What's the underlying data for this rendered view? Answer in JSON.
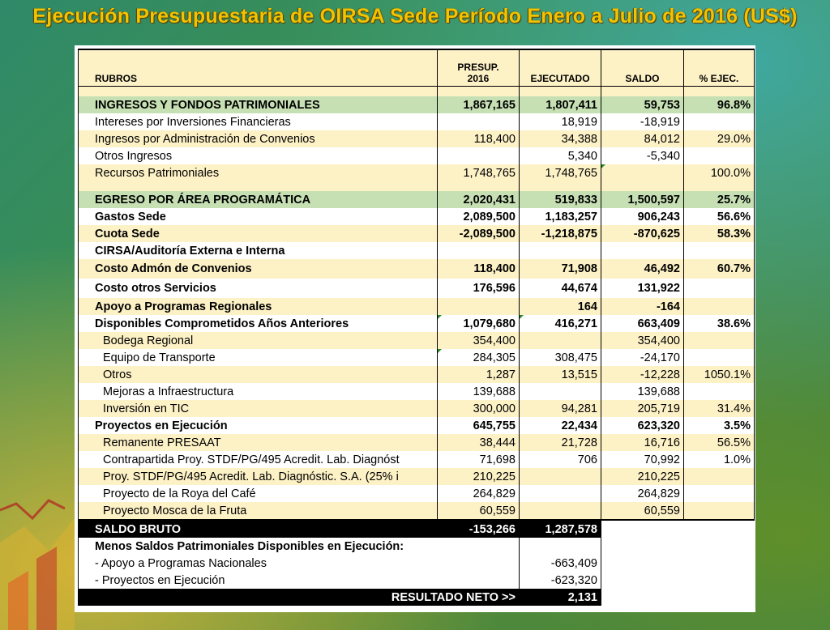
{
  "title": "Ejecución Presupuestaria de OIRSA Sede Período Enero a Julio de 2016 (US$)",
  "columns": {
    "rubros": "RUBROS",
    "presup_line1": "PRESUP.",
    "presup_line2": "2016",
    "ejecutado": "EJECUTADO",
    "saldo": "SALDO",
    "pct": "% EJEC."
  },
  "rows": [
    {
      "label": "INGRESOS Y FONDOS PATRIMONIALES",
      "presup": "1,867,165",
      "ejec": "1,807,411",
      "saldo": "59,753",
      "pct": "96.8%"
    },
    {
      "label": "Intereses por Inversiones Financieras",
      "presup": "",
      "ejec": "18,919",
      "saldo": "-18,919",
      "pct": ""
    },
    {
      "label": "Ingresos por Administración de Convenios",
      "presup": "118,400",
      "ejec": "34,388",
      "saldo": "84,012",
      "pct": "29.0%"
    },
    {
      "label": "Otros Ingresos",
      "presup": "",
      "ejec": "5,340",
      "saldo": "-5,340",
      "pct": ""
    },
    {
      "label": "Recursos Patrimoniales",
      "presup": "1,748,765",
      "ejec": "1,748,765",
      "saldo": "",
      "pct": "100.0%"
    },
    {
      "label": "EGRESO POR ÁREA PROGRAMÁTICA",
      "presup": "2,020,431",
      "ejec": "519,833",
      "saldo": "1,500,597",
      "pct": "25.7%"
    },
    {
      "label": "Gastos Sede",
      "presup": "2,089,500",
      "ejec": "1,183,257",
      "saldo": "906,243",
      "pct": "56.6%"
    },
    {
      "label": "Cuota Sede",
      "presup": "-2,089,500",
      "ejec": "-1,218,875",
      "saldo": "-870,625",
      "pct": "58.3%"
    },
    {
      "label": "CIRSA/Auditoría Externa e Interna",
      "presup": "",
      "ejec": "",
      "saldo": "",
      "pct": ""
    },
    {
      "label": "Costo Admón de Convenios",
      "presup": "118,400",
      "ejec": "71,908",
      "saldo": "46,492",
      "pct": "60.7%"
    },
    {
      "label": "Costo otros Servicios",
      "presup": "176,596",
      "ejec": "44,674",
      "saldo": "131,922",
      "pct": ""
    },
    {
      "label": "Apoyo a Programas Regionales",
      "presup": "",
      "ejec": "164",
      "saldo": "-164",
      "pct": ""
    },
    {
      "label": "Disponibles Comprometidos Años Anteriores",
      "presup": "1,079,680",
      "ejec": "416,271",
      "saldo": "663,409",
      "pct": "38.6%"
    },
    {
      "label": "Bodega Regional",
      "presup": "354,400",
      "ejec": "",
      "saldo": "354,400",
      "pct": ""
    },
    {
      "label": "Equipo de Transporte",
      "presup": "284,305",
      "ejec": "308,475",
      "saldo": "-24,170",
      "pct": ""
    },
    {
      "label": "Otros",
      "presup": "1,287",
      "ejec": "13,515",
      "saldo": "-12,228",
      "pct": "1050.1%"
    },
    {
      "label": "Mejoras a Infraestructura",
      "presup": "139,688",
      "ejec": "",
      "saldo": "139,688",
      "pct": ""
    },
    {
      "label": "Inversión en TIC",
      "presup": "300,000",
      "ejec": "94,281",
      "saldo": "205,719",
      "pct": "31.4%"
    },
    {
      "label": "Proyectos en Ejecución",
      "presup": "645,755",
      "ejec": "22,434",
      "saldo": "623,320",
      "pct": "3.5%"
    },
    {
      "label": "Remanente PRESAAT",
      "presup": "38,444",
      "ejec": "21,728",
      "saldo": "16,716",
      "pct": "56.5%"
    },
    {
      "label": "Contrapartida Proy. STDF/PG/495 Acredit. Lab. Diagnóst",
      "presup": "71,698",
      "ejec": "706",
      "saldo": "70,992",
      "pct": "1.0%"
    },
    {
      "label": "Proy. STDF/PG/495 Acredit. Lab. Diagnóstic. S.A. (25% i",
      "presup": "210,225",
      "ejec": "",
      "saldo": "210,225",
      "pct": ""
    },
    {
      "label": "Proyecto de la Roya del Café",
      "presup": "264,829",
      "ejec": "",
      "saldo": "264,829",
      "pct": ""
    },
    {
      "label": "Proyecto Mosca de la Fruta",
      "presup": "60,559",
      "ejec": "",
      "saldo": "60,559",
      "pct": ""
    }
  ],
  "saldo_bruto": {
    "label": "SALDO BRUTO",
    "presup": "-153,266",
    "ejec": "1,287,578"
  },
  "menos": {
    "label": "Menos Saldos Patrimoniales Disponibles en Ejecución:"
  },
  "apoyo_nac": {
    "label": "- Apoyo a Programas Nacionales",
    "ejec": "-663,409"
  },
  "proy_ejec": {
    "label": "- Proyectos en Ejecución",
    "ejec": "-623,320"
  },
  "resultado": {
    "label": "RESULTADO NETO >>",
    "ejec": "2,131"
  },
  "colors": {
    "title": "#f2c300",
    "cream": "#fdf1c6",
    "green": "#c6e0b4"
  }
}
